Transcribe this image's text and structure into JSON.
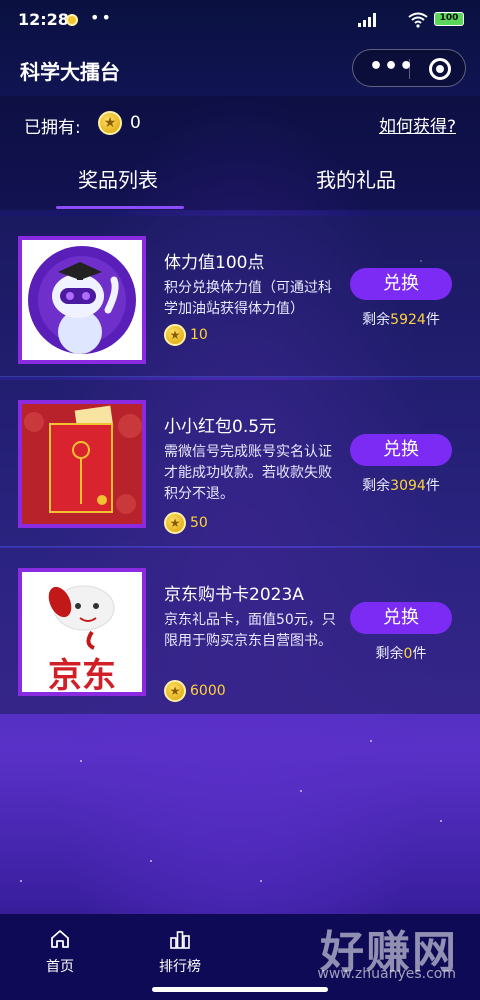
{
  "status_bar": {
    "time": "12:28",
    "dots": "••",
    "battery": "100"
  },
  "nav": {
    "title": "科学大擂台"
  },
  "owned": {
    "label": "已拥有:",
    "count": "0",
    "how_to_get": "如何获得?"
  },
  "tabs": {
    "prizes": "奖品列表",
    "mine": "我的礼品"
  },
  "items": [
    {
      "title": "体力值100点",
      "desc": "积分兑换体力值（可通过科学加油站获得体力值）",
      "price": "10",
      "button": "兑换",
      "remain_prefix": "剩余",
      "remain_num": "5924",
      "remain_suffix": "件"
    },
    {
      "title": "小小红包0.5元",
      "desc": "需微信号完成账号实名认证才能成功收款。若收款失败积分不退。",
      "price": "50",
      "button": "兑换",
      "remain_prefix": "剩余",
      "remain_num": "3094",
      "remain_suffix": "件"
    },
    {
      "title": "京东购书卡2023A",
      "desc": "京东礼品卡，面值50元，只限用于购买京东自营图书。",
      "price": "6000",
      "button": "兑换",
      "remain_prefix": "剩余",
      "remain_num": "0",
      "remain_suffix": "件",
      "thumb_text": "京东"
    }
  ],
  "tabbar": {
    "home": "首页",
    "ranking": "排行榜"
  },
  "watermark": {
    "text": "好赚网",
    "url": "www.zhuanyes.com"
  },
  "colors": {
    "accent": "#7b2bf3",
    "highlight": "#ffd33a",
    "tabbar": "#0f0a55"
  }
}
